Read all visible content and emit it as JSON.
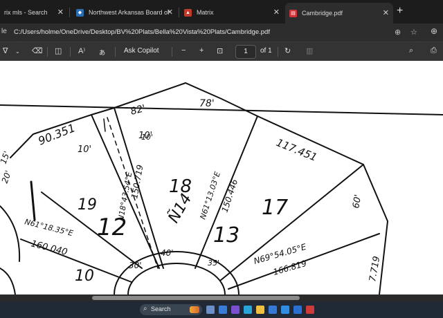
{
  "tabs": [
    {
      "label": "rix mls - Search",
      "icon": "bing-search-icon",
      "active": false
    },
    {
      "label": "Northwest Arkansas Board of",
      "icon": "nwa-board-icon",
      "active": false
    },
    {
      "label": "Matrix",
      "icon": "matrix-icon",
      "active": false
    },
    {
      "label": "Cambridge.pdf",
      "icon": "pdf-icon",
      "active": true
    }
  ],
  "address": {
    "left_glyph": "le",
    "url": "C:/Users/holme/OneDrive/Desktop/BV%20Plats/Bella%20Vista%20Plats/Cambridge.pdf"
  },
  "pdf_toolbar": {
    "ask_copilot": "Ask Copilot",
    "page_current": "1",
    "page_total": "of 1"
  },
  "plat": {
    "labels": [
      "90.351",
      "10'",
      "10'",
      "82'",
      "78'",
      "117.451",
      "18",
      "Ñ14",
      "19",
      "12",
      "N18°43.54°E",
      "150.719",
      "N61°13.03°E",
      "150.446",
      "13",
      "17",
      "60'",
      "N61°18.35°E",
      "160.040",
      "N69°54.05°E",
      "166.819",
      "10'",
      "40'",
      "30'",
      "35'",
      "20'",
      "15'",
      "10",
      "7.719"
    ]
  },
  "taskbar": {
    "search_label": "Search"
  }
}
